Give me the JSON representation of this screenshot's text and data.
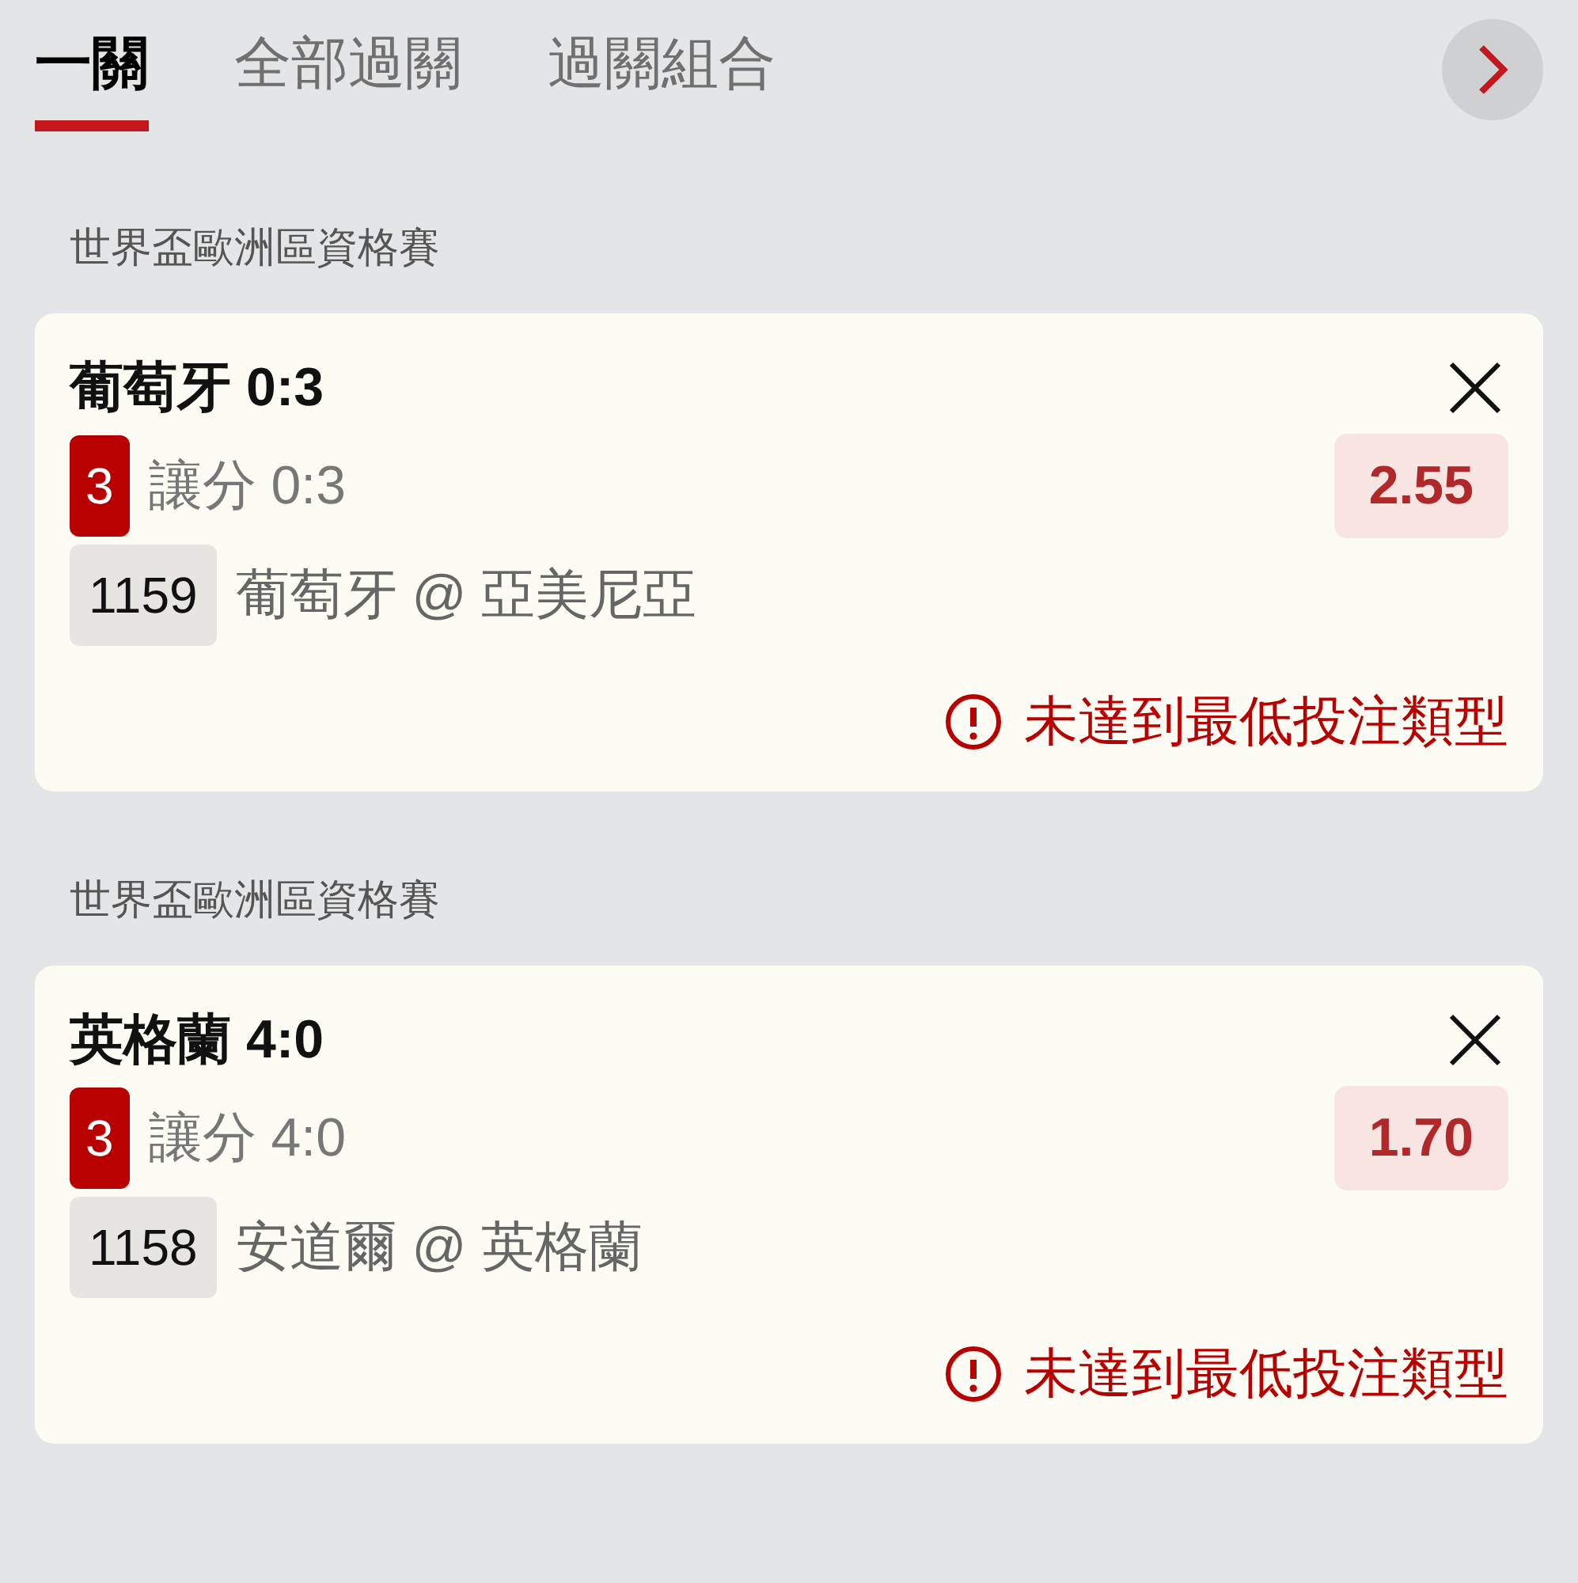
{
  "tabs": [
    {
      "label": "一關",
      "selected": true
    },
    {
      "label": "全部過關",
      "selected": false
    },
    {
      "label": "過關組合",
      "selected": false
    }
  ],
  "bets": [
    {
      "league": "世界盃歐洲區資格賽",
      "title": "葡萄牙 0:3",
      "pick": "3",
      "market": "讓分 0:3",
      "odds": "2.55",
      "match_no": "1159",
      "match": "葡萄牙 @ 亞美尼亞",
      "warning": "未達到最低投注類型"
    },
    {
      "league": "世界盃歐洲區資格賽",
      "title": "英格蘭 4:0",
      "pick": "3",
      "market": "讓分 4:0",
      "odds": "1.70",
      "match_no": "1158",
      "match": "安道爾 @ 英格蘭",
      "warning": "未達到最低投注類型"
    }
  ]
}
